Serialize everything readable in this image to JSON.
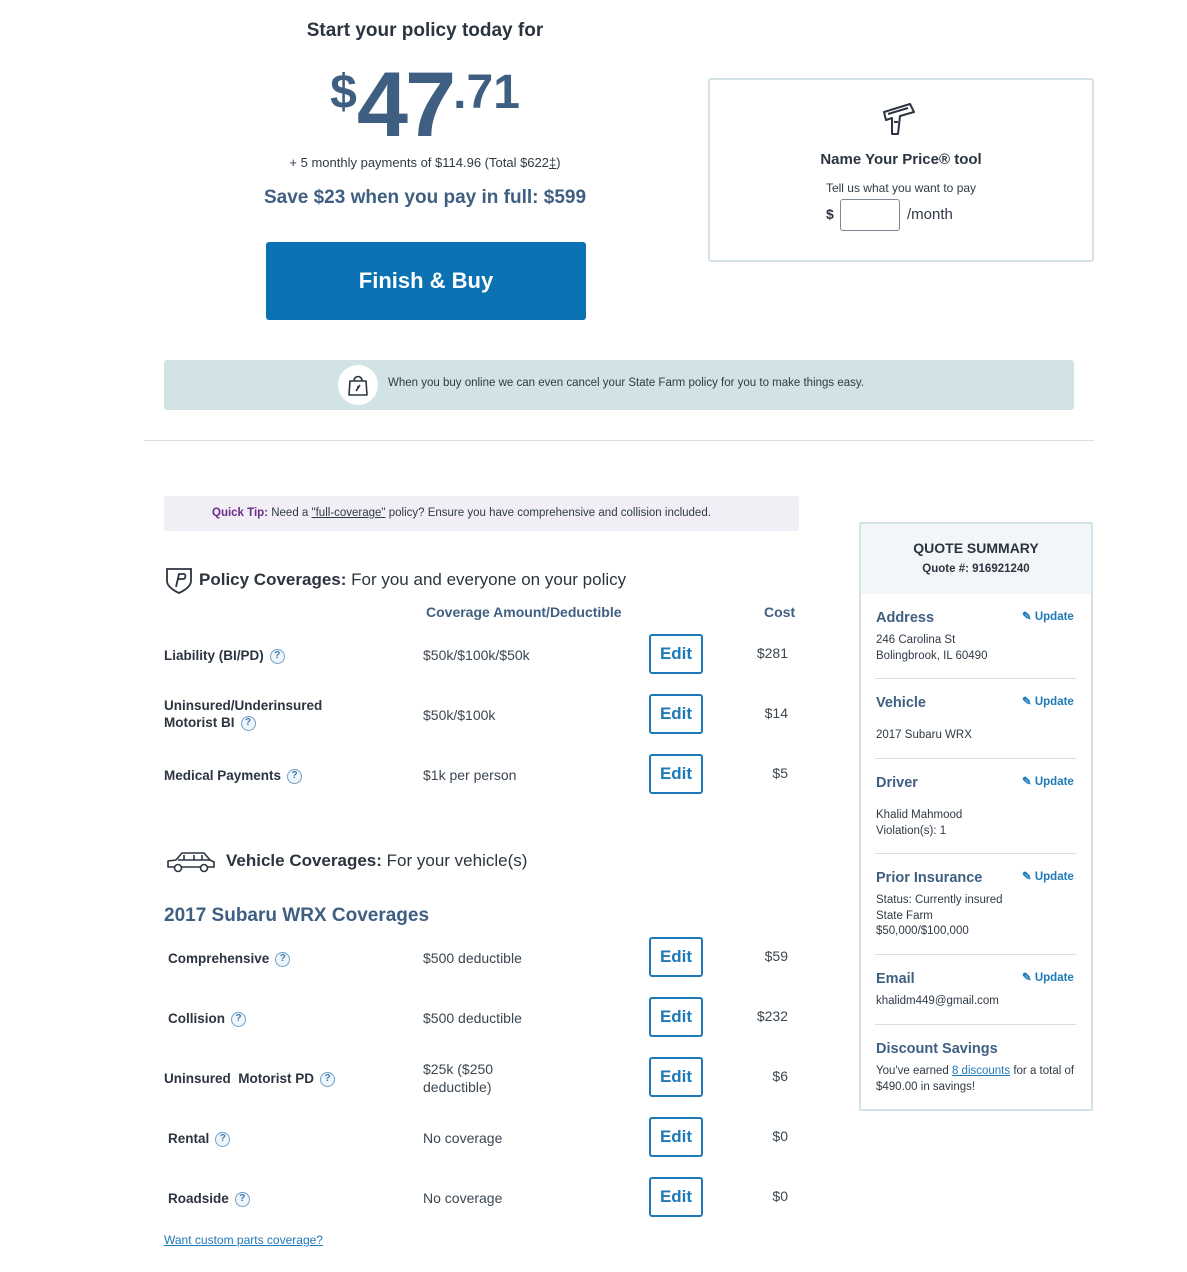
{
  "price": {
    "headline": "Start your policy today for",
    "dollar_sign": "$",
    "whole": "47",
    "cents": ".71",
    "monthly_note": "+ 5 monthly payments of $114.96 (Total $622",
    "monthly_note_mark": "‡",
    "monthly_note_close": ")",
    "pay_in_full": "Save $23 when you pay in full: $599",
    "finish_button": "Finish & Buy"
  },
  "name_your_price": {
    "title": "Name Your Price® tool",
    "subtitle": "Tell us what you want to pay",
    "dollar": "$",
    "input_value": "",
    "per_month": "/month"
  },
  "banner": {
    "text": "When you buy online we can even cancel your State Farm policy for you to make things easy."
  },
  "tip": {
    "label": "Quick Tip:",
    "pre": " Need a ",
    "link": "\"full-coverage\"",
    "post": " policy? Ensure you have comprehensive and collision included."
  },
  "policy_section": {
    "title": "Policy Coverages:",
    "subtitle": " For you and everyone on your policy",
    "col_amount": "Coverage Amount/Deductible",
    "col_cost": "Cost",
    "rows": [
      {
        "label": "Liability (BI/PD)",
        "amount": "$50k/$100k/$50k",
        "cost": "$281"
      },
      {
        "label": "Uninsured/Underinsured Motorist BI",
        "amount": "$50k/$100k",
        "cost": "$14"
      },
      {
        "label": "Medical Payments",
        "amount": "$1k per person",
        "cost": "$5"
      }
    ]
  },
  "vehicle_section": {
    "title": "Vehicle Coverages:",
    "subtitle": " For your vehicle(s)",
    "vehicle_title": "2017 Subaru WRX Coverages",
    "rows": [
      {
        "label": "Comprehensive",
        "amount": "$500 deductible",
        "cost": "$59"
      },
      {
        "label": "Collision",
        "amount": "$500 deductible",
        "cost": "$232"
      },
      {
        "label": "Uninsured  Motorist PD",
        "amount": "$25k ($250 deductible)",
        "cost": "$6"
      },
      {
        "label": "Rental",
        "amount": "No coverage",
        "cost": "$0"
      },
      {
        "label": "Roadside",
        "amount": "No coverage",
        "cost": "$0"
      }
    ],
    "custom_parts_link": "Want custom parts coverage?"
  },
  "edit_label": "Edit",
  "help_glyph": "?",
  "quote_summary": {
    "title": "QUOTE SUMMARY",
    "quote_number": "Quote #: 916921240",
    "update_label": "Update",
    "address_label": "Address",
    "address_line1": "246 Carolina St",
    "address_line2": "Bolingbrook, IL 60490",
    "vehicle_label": "Vehicle",
    "vehicle_value": "2017 Subaru WRX",
    "driver_label": "Driver",
    "driver_name": "Khalid Mahmood",
    "driver_violations": "Violation(s): 1",
    "prior_label": "Prior Insurance",
    "prior_status": "Status: Currently insured",
    "prior_company": "State Farm",
    "prior_limits": "$50,000/$100,000",
    "email_label": "Email",
    "email_value": "khalidm449@gmail.com",
    "discount_label": "Discount Savings",
    "discount_pre": "You've earned ",
    "discount_link": "8 discounts",
    "discount_post": " for a total of $490.00 in savings!"
  },
  "colors": {
    "primary_button": "#0a72b3",
    "heading_blue": "#3f5f82",
    "tip_purple": "#6a2c84",
    "banner_bg": "#d2e3e6"
  },
  "icons": {
    "name_your_price": "price-gun-icon",
    "banner": "shopping-bag-icon",
    "policy": "shield-icon",
    "vehicle": "car-icon",
    "help": "question-mark-icon",
    "update": "pencil-icon"
  }
}
